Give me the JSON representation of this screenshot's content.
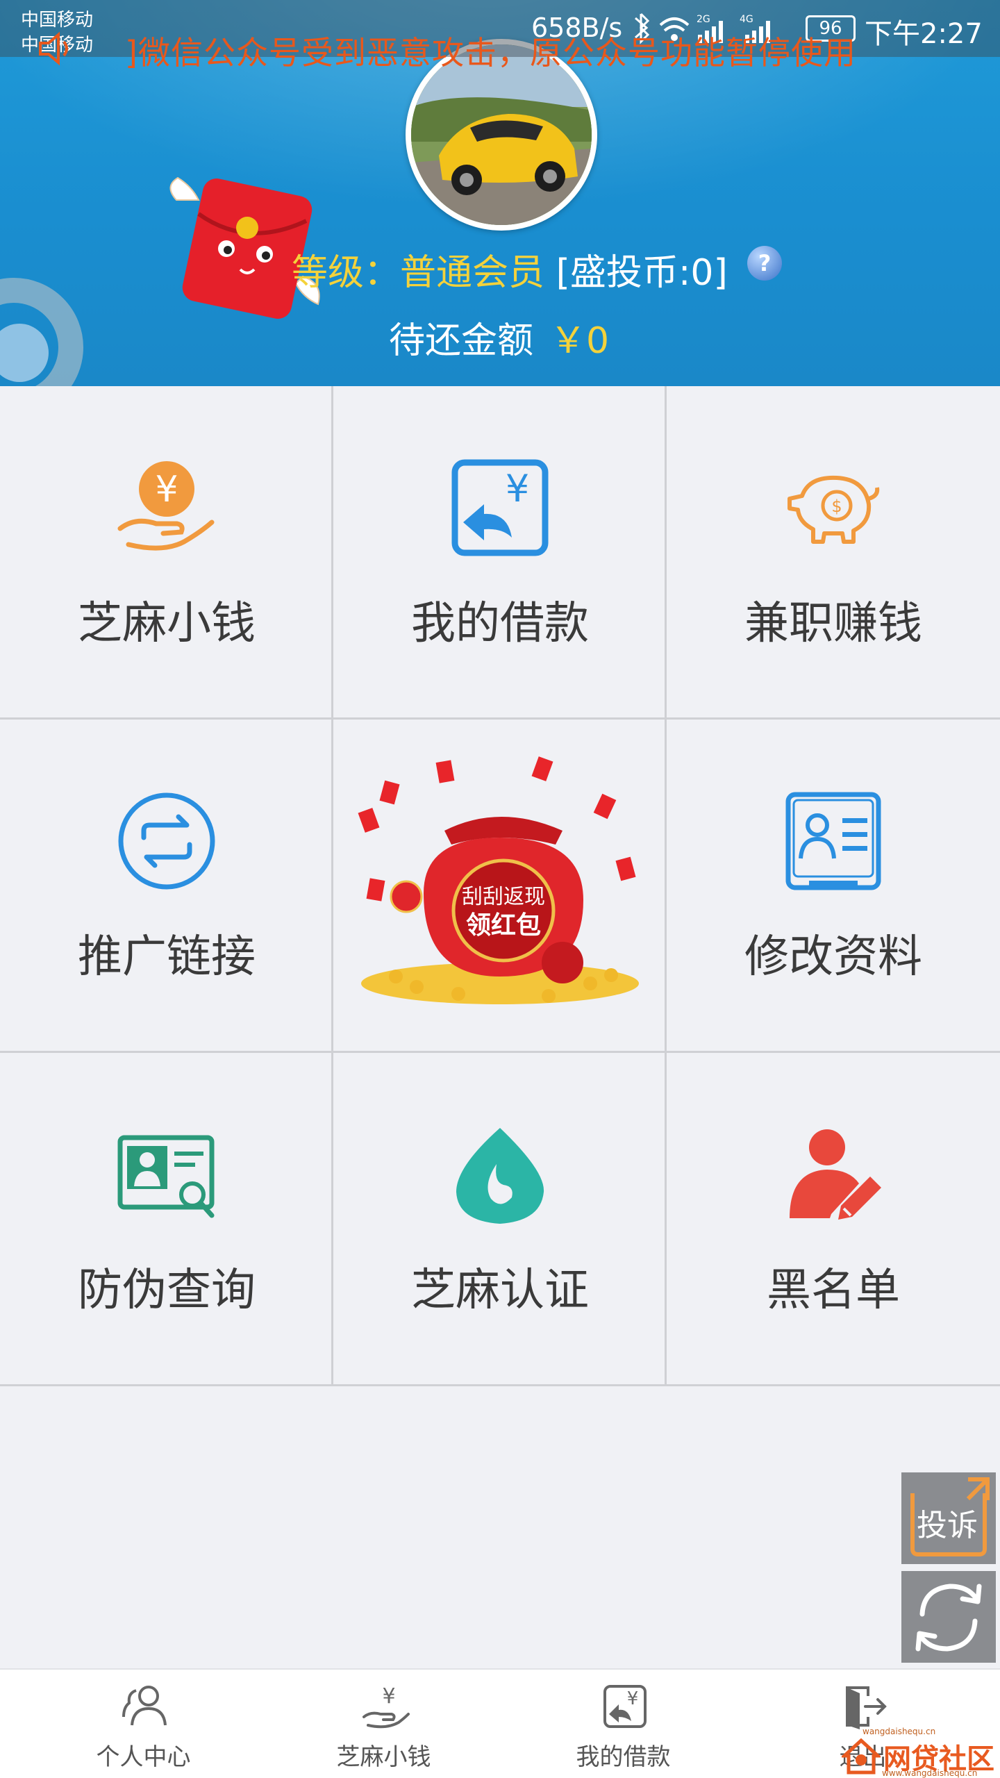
{
  "status_bar": {
    "carrier1": "中国移动",
    "carrier2": "中国移动",
    "net_speed": "658B/s",
    "battery": "96",
    "time": "下午2:27"
  },
  "notice": {
    "text": "]微信公众号受到恶意攻击，原公众号功能暂停使用"
  },
  "profile": {
    "level_label": "等级：",
    "level_value": "普通会员",
    "coins_text": "[盛投币:0]",
    "help_mark": "?",
    "due_label": "待还金额",
    "due_amount": "￥0"
  },
  "grid": [
    {
      "label": "芝麻小钱",
      "icon": "hand-coin-icon"
    },
    {
      "label": "我的借款",
      "icon": "loan-return-icon"
    },
    {
      "label": "兼职赚钱",
      "icon": "piggy-bank-icon"
    },
    {
      "label": "推广链接",
      "icon": "share-arrows-icon"
    },
    {
      "label": "刮刮返现 领红包",
      "icon": "red-envelope-bag-image"
    },
    {
      "label": "修改资料",
      "icon": "profile-card-icon"
    },
    {
      "label": "防伪查询",
      "icon": "id-search-icon"
    },
    {
      "label": "芝麻认证",
      "icon": "drop-icon"
    },
    {
      "label": "黑名单",
      "icon": "user-edit-icon"
    }
  ],
  "promo_text1": "刮刮返现",
  "promo_text2": "领红包",
  "floating": {
    "complain": "投诉"
  },
  "bottom_nav": [
    {
      "label": "个人中心",
      "icon": "user-group-icon"
    },
    {
      "label": "芝麻小钱",
      "icon": "hand-coin-icon"
    },
    {
      "label": "我的借款",
      "icon": "loan-return-icon"
    },
    {
      "label": "退出",
      "icon": "logout-icon"
    }
  ],
  "watermark": {
    "top": "wangdaishequ.cn",
    "main": "网贷社区",
    "sub": "www.wangdaishequ.cn"
  },
  "colors": {
    "header_blue": "#1a8ed0",
    "accent_orange": "#f19a3e",
    "accent_blue": "#2a8fe0",
    "gold_text": "#f4d23b",
    "teal": "#2bb5a6",
    "red": "#e8483c"
  }
}
